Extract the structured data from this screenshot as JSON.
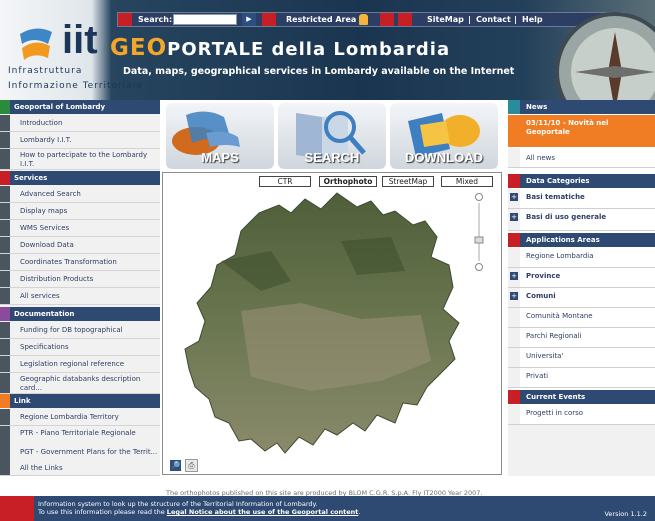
{
  "header": {
    "search_label": "Search:",
    "search_value": "",
    "restricted_area": "Restricted Area",
    "sitemap": "SiteMap",
    "contact": "Contact",
    "help": "Help",
    "sep": "|",
    "logo_text": "iit",
    "org_line1": "Infrastruttura",
    "org_line2": "Informazione Territoriale",
    "title_geo": "GEO",
    "title_rest": "PORTALE della Lombardia",
    "subtitle": "Data, maps, geographical services in Lombardy available on the Internet"
  },
  "left": {
    "geoportal_title": "Geoportal of Lombardy",
    "geoportal_items": [
      "Introduction",
      "Lombardy I.I.T.",
      "How to partecipate to the Lombardy I.I.T."
    ],
    "services_title": "Services",
    "services_items": [
      "Advanced Search",
      "Display maps",
      "WMS Services",
      "Download Data",
      "Coordinates Transformation",
      "Distribution Products",
      "All services"
    ],
    "documentation_title": "Documentation",
    "documentation_items": [
      "Funding for DB topographical",
      "Specifications",
      "Legislation regional reference",
      "Geographic databanks description card..."
    ],
    "link_title": "Link",
    "link_items": [
      "Regione Lombardia Territory",
      "PTR - Piano Territoriale Regionale",
      "PGT - Government Plans for the Territ...",
      "All the Links"
    ]
  },
  "center": {
    "btn_maps": "MAPS",
    "btn_search": "SEARCH",
    "btn_download": "DOWNLOAD",
    "tabs": [
      "CTR",
      "Orthophoto",
      "StreetMap",
      "Mixed"
    ],
    "active_tab": "Orthophoto",
    "credit": "The orthophotos published on this site are produced by BLOM C.G.R. S.p.A. Fly IT2000 Year 2007."
  },
  "right": {
    "news_title": "News",
    "news_item": "03/11/10 - Novità nel Geoportale",
    "all_news": "All news",
    "categories_title": "Data Categories",
    "categories": [
      "Basi tematiche",
      "Basi di uso generale"
    ],
    "areas_title": "Applications Areas",
    "areas": [
      "Regione Lombardia",
      "Province",
      "Comuni",
      "Comunità Montane",
      "Parchi Regionali",
      "Universita'",
      "Privati"
    ],
    "events_title": "Current Events",
    "events": [
      "Progetti in corso"
    ]
  },
  "footer": {
    "line1": "Information system to look up the structure of the Territorial Information of Lombardy.",
    "line2_pre": "To use this information please read the ",
    "line2_link": "Legal Notice about the use of the Geoportal content",
    "line2_post": ".",
    "version": "Version 1.1.2"
  },
  "colors": {
    "navy": "#2f4a72",
    "red": "#c81e25",
    "orange": "#f07c23",
    "green": "#2a8b3c",
    "purple": "#8b4a9c"
  }
}
